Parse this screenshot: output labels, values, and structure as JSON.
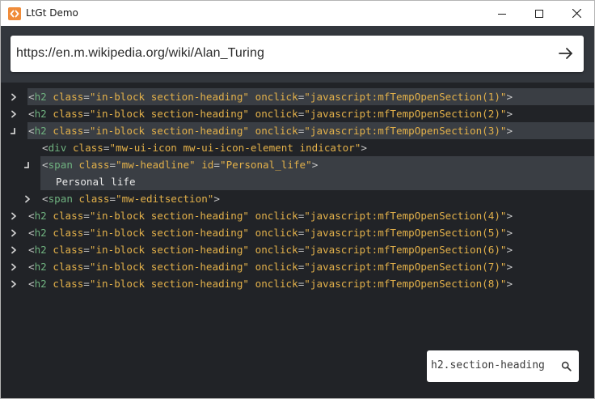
{
  "window": {
    "title": "LtGt Demo"
  },
  "urlbar": {
    "value": "https://en.m.wikipedia.org/wiki/Alan_Turing"
  },
  "tree": {
    "rows": [
      {
        "tag": "h2",
        "attrs": [
          [
            "class",
            "in-block section-heading"
          ],
          [
            "onclick",
            "javascript:mfTempOpenSection(1)"
          ]
        ],
        "toggle": "collapsed"
      },
      {
        "tag": "h2",
        "attrs": [
          [
            "class",
            "in-block section-heading"
          ],
          [
            "onclick",
            "javascript:mfTempOpenSection(2)"
          ]
        ],
        "toggle": "collapsed"
      },
      {
        "tag": "h2",
        "attrs": [
          [
            "class",
            "in-block section-heading"
          ],
          [
            "onclick",
            "javascript:mfTempOpenSection(3)"
          ]
        ],
        "toggle": "expanded"
      },
      {
        "tag": "div",
        "attrs": [
          [
            "class",
            "mw-ui-icon mw-ui-icon-element indicator"
          ]
        ],
        "toggle": "none"
      },
      {
        "tag": "span",
        "attrs": [
          [
            "class",
            "mw-headline"
          ],
          [
            "id",
            "Personal_life"
          ]
        ],
        "toggle": "expanded"
      },
      {
        "text": "Personal life"
      },
      {
        "tag": "span",
        "attrs": [
          [
            "class",
            "mw-editsection"
          ]
        ],
        "toggle": "collapsed"
      },
      {
        "tag": "h2",
        "attrs": [
          [
            "class",
            "in-block section-heading"
          ],
          [
            "onclick",
            "javascript:mfTempOpenSection(4)"
          ]
        ],
        "toggle": "collapsed"
      },
      {
        "tag": "h2",
        "attrs": [
          [
            "class",
            "in-block section-heading"
          ],
          [
            "onclick",
            "javascript:mfTempOpenSection(5)"
          ]
        ],
        "toggle": "collapsed"
      },
      {
        "tag": "h2",
        "attrs": [
          [
            "class",
            "in-block section-heading"
          ],
          [
            "onclick",
            "javascript:mfTempOpenSection(6)"
          ]
        ],
        "toggle": "collapsed"
      },
      {
        "tag": "h2",
        "attrs": [
          [
            "class",
            "in-block section-heading"
          ],
          [
            "onclick",
            "javascript:mfTempOpenSection(7)"
          ]
        ],
        "toggle": "collapsed"
      },
      {
        "tag": "h2",
        "attrs": [
          [
            "class",
            "in-block section-heading"
          ],
          [
            "onclick",
            "javascript:mfTempOpenSection(8)"
          ]
        ],
        "toggle": "collapsed"
      }
    ]
  },
  "search": {
    "value": "h2.section-heading"
  },
  "icons": {
    "app": "code-brackets-icon",
    "go": "arrow-right-icon",
    "search": "magnifier-icon",
    "collapsed": "chevron-right-icon",
    "expanded": "corner-down-icon"
  },
  "colors": {
    "background": "#212327",
    "tag": "#6fb17f",
    "attribute": "#e2b04a",
    "punctuation": "#c8c8c8",
    "text": "#e8e8e8",
    "highlight": "#3a3e44",
    "app_icon": "#f08c3a"
  }
}
